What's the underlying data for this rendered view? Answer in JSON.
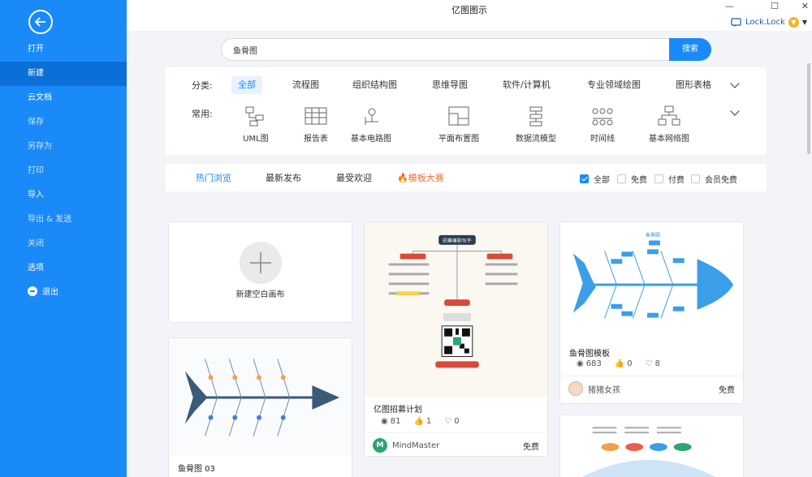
{
  "app": {
    "title": "亿图图示",
    "user": "Lock.Lock"
  },
  "sidebar": {
    "items": [
      {
        "label": "打开"
      },
      {
        "label": "新建"
      },
      {
        "label": "云文档"
      },
      {
        "label": "保存"
      },
      {
        "label": "另存为"
      },
      {
        "label": "打印"
      },
      {
        "label": "导入"
      },
      {
        "label": "导出 & 发送"
      },
      {
        "label": "关闭"
      },
      {
        "label": "选项"
      },
      {
        "label": "退出"
      }
    ]
  },
  "search": {
    "value": "鱼骨图",
    "button": "搜索"
  },
  "filter": {
    "category_label": "分类:",
    "categories": [
      "全部",
      "流程图",
      "组织结构图",
      "思维导图",
      "软件/计算机",
      "专业领域绘图",
      "图形表格"
    ],
    "common_label": "常用:",
    "common": [
      "UML图",
      "报告表",
      "基本电路图",
      "平面布置图",
      "数据流模型",
      "时间线",
      "基本网络图"
    ]
  },
  "tabs": [
    "热门浏览",
    "最新发布",
    "最受欢迎",
    "模板大赛"
  ],
  "checks": [
    {
      "label": "全部",
      "checked": true
    },
    {
      "label": "免费",
      "checked": false
    },
    {
      "label": "付费",
      "checked": false
    },
    {
      "label": "会员免费",
      "checked": false
    }
  ],
  "cards": {
    "new_blank": "新建空白画布",
    "card1": {
      "title": "鱼骨图 03"
    },
    "card2": {
      "title": "亿图招募计划",
      "poster_title": "招募兼职写手",
      "views": "81",
      "likes": "1",
      "comments": "0",
      "author": "MindMaster",
      "price": "免费"
    },
    "card3": {
      "title": "鱼骨图模板",
      "thumb_title": "鱼骨图",
      "views": "683",
      "likes": "0",
      "comments": "8",
      "author": "猪猪女孩",
      "price": "免费"
    }
  },
  "colors": {
    "accent": "#1a8af8",
    "sidebar": "#1a8af8",
    "hot": "#f56c2d"
  }
}
